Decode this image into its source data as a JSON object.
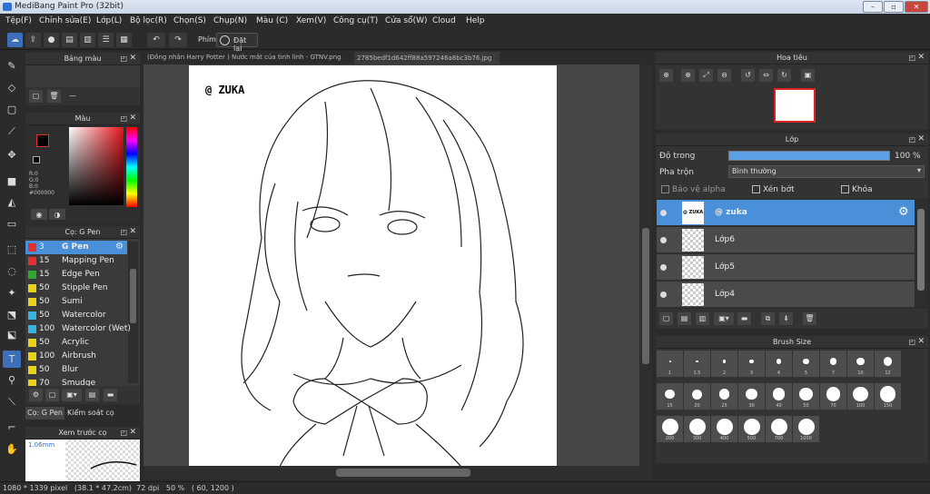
{
  "app": {
    "title": "MediBang Paint Pro (32bit)"
  },
  "menu": [
    "Tệp(F)",
    "Chỉnh sửa(E)",
    "Lớp(L)",
    "Bộ lọc(R)",
    "Chọn(S)",
    "Chụp(N)",
    "Màu (C)",
    "Xem(V)",
    "Công cụ(T)",
    "Cửa sổ(W)",
    "Cloud",
    "Help"
  ],
  "toolbar": {
    "phim_label": "Phím",
    "reset_label": "Đặt lại"
  },
  "tabs": [
    "(Đồng nhân Harry Potter ) Nước mắt của tinh linh - GTNV.png",
    "2785bedf1d642ff88a597246a8bc3b76.jpg"
  ],
  "panels": {
    "palette": {
      "title": "Bảng màu",
      "empty": "—"
    },
    "color": {
      "title": "Màu",
      "r": "R:0",
      "g": "G:0",
      "b": "B:0",
      "hex": "#000000"
    },
    "brush": {
      "title": "Cọ: G Pen"
    },
    "brush_tabs": [
      "Cọ: G Pen",
      "Kiểm soát cọ"
    ],
    "preview": {
      "title": "Xem trước cọ",
      "size": "1.06mm"
    },
    "navigator": {
      "title": "Hoa tiêu"
    },
    "layer": {
      "title": "Lớp",
      "opacity_label": "Độ trong",
      "opacity_value": "100 %",
      "blend_label": "Pha trộn",
      "blend_value": "Bình thường",
      "protect_alpha": "Bảo vệ alpha",
      "clip": "Xén bớt",
      "lock": "Khóa"
    },
    "brushsize": {
      "title": "Brush Size"
    }
  },
  "brushes": [
    {
      "size": "3",
      "name": "G Pen",
      "color": "#e23030"
    },
    {
      "size": "15",
      "name": "Mapping Pen",
      "color": "#e23030"
    },
    {
      "size": "15",
      "name": "Edge Pen",
      "color": "#2ea82e"
    },
    {
      "size": "50",
      "name": "Stipple Pen",
      "color": "#e8d21c"
    },
    {
      "size": "50",
      "name": "Sumi",
      "color": "#e8d21c"
    },
    {
      "size": "50",
      "name": "Watercolor",
      "color": "#39b4e0"
    },
    {
      "size": "100",
      "name": "Watercolor (Wet)",
      "color": "#39b4e0"
    },
    {
      "size": "50",
      "name": "Acrylic",
      "color": "#e8d21c"
    },
    {
      "size": "100",
      "name": "Airbrush",
      "color": "#e8d21c"
    },
    {
      "size": "50",
      "name": "Blur",
      "color": "#e8d21c"
    },
    {
      "size": "70",
      "name": "Smudge",
      "color": "#e8d21c"
    }
  ],
  "layers": [
    {
      "name": "@ zuka",
      "thumb": "@ ZUKA"
    },
    {
      "name": "Lớp6"
    },
    {
      "name": "Lớp5"
    },
    {
      "name": "Lớp4"
    }
  ],
  "brush_sizes": [
    "1",
    "1.5",
    "2",
    "3",
    "4",
    "5",
    "7",
    "10",
    "12",
    "15",
    "20",
    "25",
    "30",
    "40",
    "50",
    "70",
    "100",
    "150",
    "200",
    "300",
    "400",
    "500",
    "700",
    "1000"
  ],
  "canvas": {
    "watermark": "@ ZUKA"
  },
  "status": {
    "text": "1080 * 1339 pixel   (38.1 * 47.2cm)  72 dpi   50 %   ( 60, 1200 )"
  }
}
